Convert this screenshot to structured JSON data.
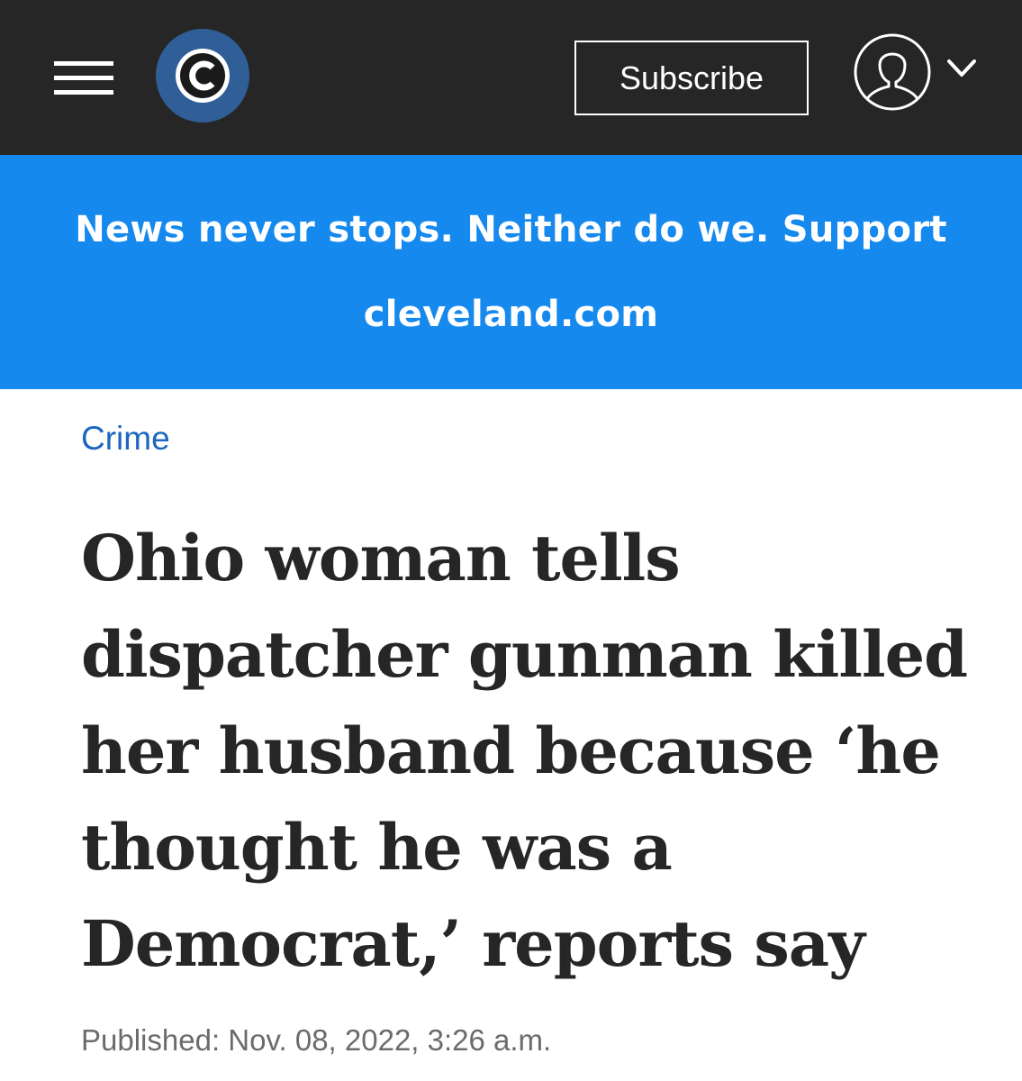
{
  "header": {
    "menu_icon": "hamburger-menu-icon",
    "logo_icon": "cleveland-c-logo",
    "subscribe_label": "Subscribe",
    "account_icon": "user-avatar-icon",
    "account_dropdown_icon": "chevron-down-icon",
    "background_color": "#262626"
  },
  "banner": {
    "line1": "News never stops. Neither do we. Support",
    "line2": "cleveland.com",
    "background_color": "#1589ee"
  },
  "article": {
    "category": "Crime",
    "category_color": "#1c67c0",
    "headline_lines": [
      "Ohio woman tells",
      "dispatcher gunman killed",
      "her husband because ‘he",
      "thought he was a",
      "Democrat,’ reports say"
    ],
    "published": "Published: Nov. 08, 2022, 3:26 a.m."
  }
}
